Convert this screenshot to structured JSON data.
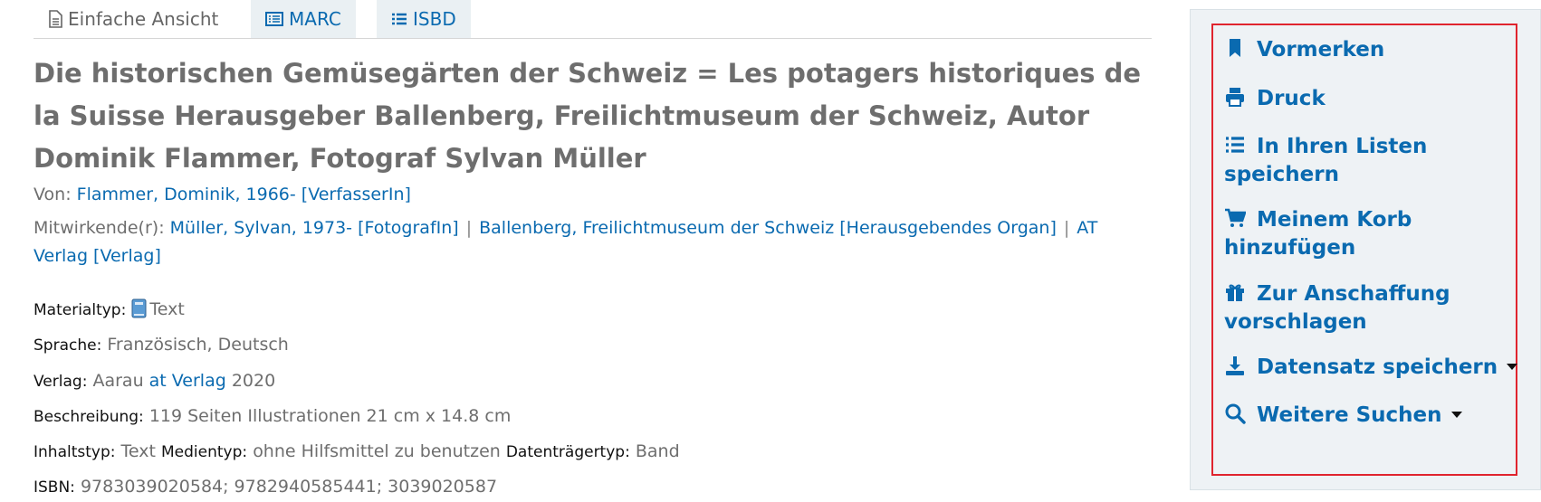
{
  "tabs": [
    {
      "label": "Einfache Ansicht",
      "icon": "document-icon"
    },
    {
      "label": "MARC",
      "icon": "list-box-icon"
    },
    {
      "label": "ISBD",
      "icon": "list-icon"
    }
  ],
  "record": {
    "title": "Die historischen Gemüsegärten der Schweiz = Les potagers historiques de la Suisse Herausgeber Ballenberg, Freilichtmuseum der Schweiz, Autor Dominik Flammer, Fotograf Sylvan Müller",
    "author_label": "Von:",
    "author": "Flammer, Dominik, 1966- [VerfasserIn]",
    "contributors_label": "Mitwirkende(r):",
    "contributors": [
      "Müller, Sylvan, 1973- [FotografIn]",
      "Ballenberg, Freilichtmuseum der Schweiz [Herausgebendes Organ]",
      "AT Verlag [Verlag]"
    ],
    "contributor_sep": "|",
    "material_label": "Materialtyp:",
    "material": "Text",
    "language_label": "Sprache:",
    "language": "Französisch, Deutsch",
    "publisher_label": "Verlag:",
    "publisher_place": "Aarau",
    "publisher_name": "at Verlag",
    "publisher_year": "2020",
    "description_label": "Beschreibung:",
    "description": "119 Seiten Illustrationen 21 cm x 14.8 cm",
    "content_label": "Inhaltstyp:",
    "content": "Text",
    "media_label": "Medientyp:",
    "media": "ohne Hilfsmittel zu benutzen",
    "carrier_label": "Datenträgertyp:",
    "carrier": "Band",
    "isbn_label": "ISBN:",
    "isbn": "9783039020584; 9782940585441; 3039020587"
  },
  "actions": [
    {
      "label": "Vormerken",
      "icon": "bookmark-icon"
    },
    {
      "label": "Druck",
      "icon": "print-icon"
    },
    {
      "label1": "In Ihren Listen",
      "label2": "speichern",
      "icon": "list-icon"
    },
    {
      "label1": "Meinem Korb",
      "label2": "hinzufügen",
      "icon": "cart-icon"
    },
    {
      "label1": "Zur Anschaffung",
      "label2": "vorschlagen",
      "icon": "gift-icon"
    },
    {
      "label": "Datensatz speichern",
      "icon": "download-icon"
    },
    {
      "label": "Weitere Suchen",
      "icon": "search-icon"
    }
  ],
  "colors": {
    "link": "#0a6ab0",
    "highlight_border": "#e0242e",
    "sidebar_bg": "#eef2f5"
  }
}
